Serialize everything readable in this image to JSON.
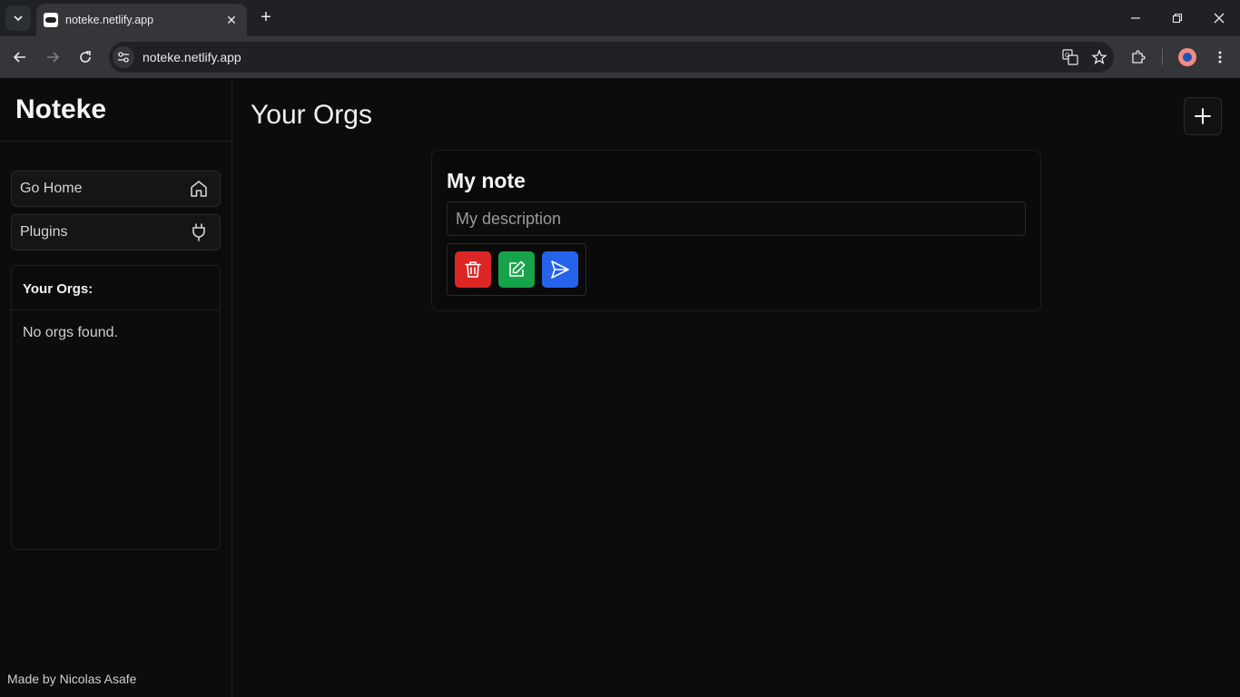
{
  "browser": {
    "tab_title": "noteke.netlify.app",
    "url": "noteke.netlify.app",
    "new_tab_symbol": "+",
    "close_symbol": "✕"
  },
  "sidebar": {
    "brand": "Noteke",
    "nav": [
      {
        "label": "Go Home",
        "icon": "home-icon"
      },
      {
        "label": "Plugins",
        "icon": "plug-icon"
      }
    ],
    "orgs_heading": "Your Orgs:",
    "orgs_empty": "No orgs found.",
    "footer": "Made by Nicolas Asafe"
  },
  "main": {
    "title": "Your Orgs",
    "add_icon": "plus-icon",
    "note": {
      "title": "My note",
      "description_placeholder": "My description",
      "actions": [
        {
          "name": "delete",
          "icon": "trash-icon",
          "color": "#dc2626"
        },
        {
          "name": "edit",
          "icon": "edit-icon",
          "color": "#16a34a"
        },
        {
          "name": "send",
          "icon": "send-icon",
          "color": "#2563eb"
        }
      ]
    }
  }
}
